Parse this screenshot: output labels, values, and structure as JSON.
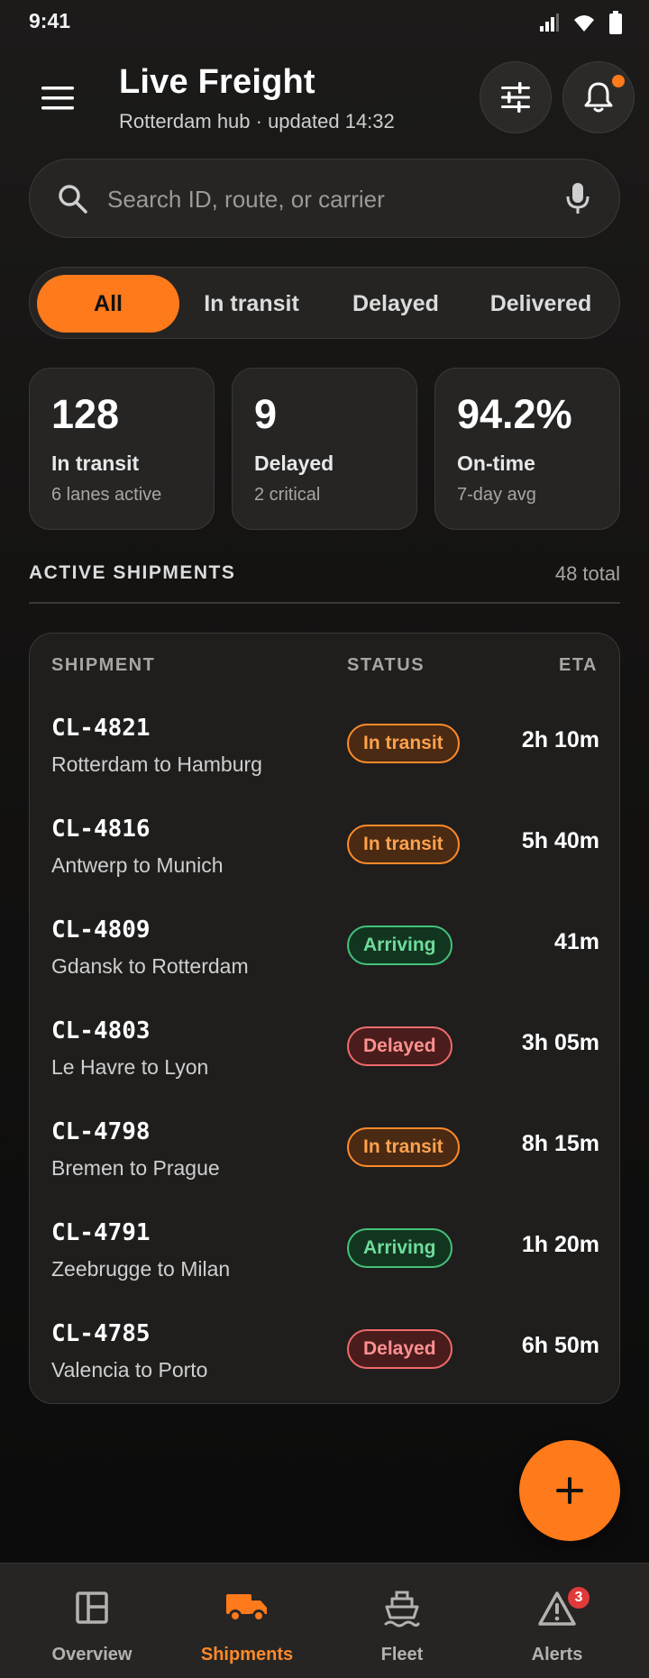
{
  "status_bar": {
    "time": "9:41"
  },
  "header": {
    "title": "Live Freight",
    "subtitle": "Rotterdam hub · updated 14:32"
  },
  "search": {
    "placeholder": "Search ID, route, or carrier",
    "value": ""
  },
  "filters": [
    "All",
    "In transit",
    "Delayed",
    "Delivered"
  ],
  "active_filter": "All",
  "stats": [
    {
      "value": "128",
      "label": "In transit",
      "sub": "6 lanes active"
    },
    {
      "value": "9",
      "label": "Delayed",
      "sub": "2 critical"
    },
    {
      "value": "94.2%",
      "label": "On-time",
      "sub": "7-day avg"
    }
  ],
  "section": {
    "title": "ACTIVE SHIPMENTS",
    "count": "48 total"
  },
  "table": {
    "headers": {
      "shipment": "SHIPMENT",
      "status": "STATUS",
      "eta": "ETA"
    },
    "rows": [
      {
        "id": "CL-4821",
        "route": "Rotterdam to Hamburg",
        "status": "In transit",
        "eta": "2h 10m"
      },
      {
        "id": "CL-4816",
        "route": "Antwerp to Munich",
        "status": "In transit",
        "eta": "5h 40m"
      },
      {
        "id": "CL-4809",
        "route": "Gdansk to Rotterdam",
        "status": "Arriving",
        "eta": "41m"
      },
      {
        "id": "CL-4803",
        "route": "Le Havre to Lyon",
        "status": "Delayed",
        "eta": "3h 05m"
      },
      {
        "id": "CL-4798",
        "route": "Bremen to Prague",
        "status": "In transit",
        "eta": "8h 15m"
      },
      {
        "id": "CL-4791",
        "route": "Zeebrugge to Milan",
        "status": "Arriving",
        "eta": "1h 20m"
      },
      {
        "id": "CL-4785",
        "route": "Valencia to Porto",
        "status": "Delayed",
        "eta": "6h 50m"
      }
    ]
  },
  "nav": {
    "items": [
      {
        "label": "Overview",
        "icon": "overview-icon"
      },
      {
        "label": "Shipments",
        "icon": "truck-icon"
      },
      {
        "label": "Fleet",
        "icon": "ship-icon"
      },
      {
        "label": "Alerts",
        "icon": "alert-icon"
      }
    ],
    "active": "Shipments",
    "alerts_badge": "3"
  },
  "colors": {
    "accent": "#ff7a1a",
    "transit": "#ffa24d",
    "arriving": "#6fdc9b",
    "delayed": "#ff9090",
    "background": "#141312"
  }
}
